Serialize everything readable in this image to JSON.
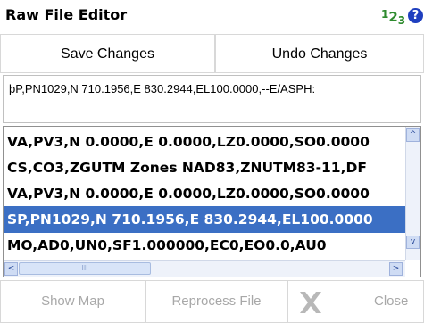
{
  "window": {
    "title": "Raw File Editor"
  },
  "header_icons": {
    "digits": [
      "1",
      "2",
      "3"
    ],
    "help_glyph": "?"
  },
  "toolbar": {
    "save_label": "Save Changes",
    "undo_label": "Undo Changes"
  },
  "editor": {
    "current_line": "þP,PN1029,N 710.1956,E 830.2944,EL100.0000,--E/ASPH:"
  },
  "list": {
    "rows": [
      {
        "text": "VA,PV3,N 0.0000,E 0.0000,LZ0.0000,SO0.0000",
        "selected": false
      },
      {
        "text": "CS,CO3,ZGUTM Zones NAD83,ZNUTM83-11,DF",
        "selected": false
      },
      {
        "text": "VA,PV3,N 0.0000,E 0.0000,LZ0.0000,SO0.0000",
        "selected": false
      },
      {
        "text": "SP,PN1029,N 710.1956,E 830.2944,EL100.0000",
        "selected": true
      },
      {
        "text": "MO,AD0,UN0,SF1.000000,EC0,EO0.0,AU0",
        "selected": false
      }
    ],
    "scroll_up_glyph": "^",
    "scroll_down_glyph": "v",
    "scroll_left_glyph": "<",
    "scroll_right_glyph": ">",
    "thumb_grip": "III"
  },
  "actions": {
    "show_map_label": "Show Map",
    "reprocess_label": "Reprocess File",
    "close_label": "Close"
  },
  "colors": {
    "selection": "#3b6fc4",
    "digits": "#2e8b2e",
    "help": "#1f3fbf",
    "disabled_text": "#a8a8a8"
  }
}
